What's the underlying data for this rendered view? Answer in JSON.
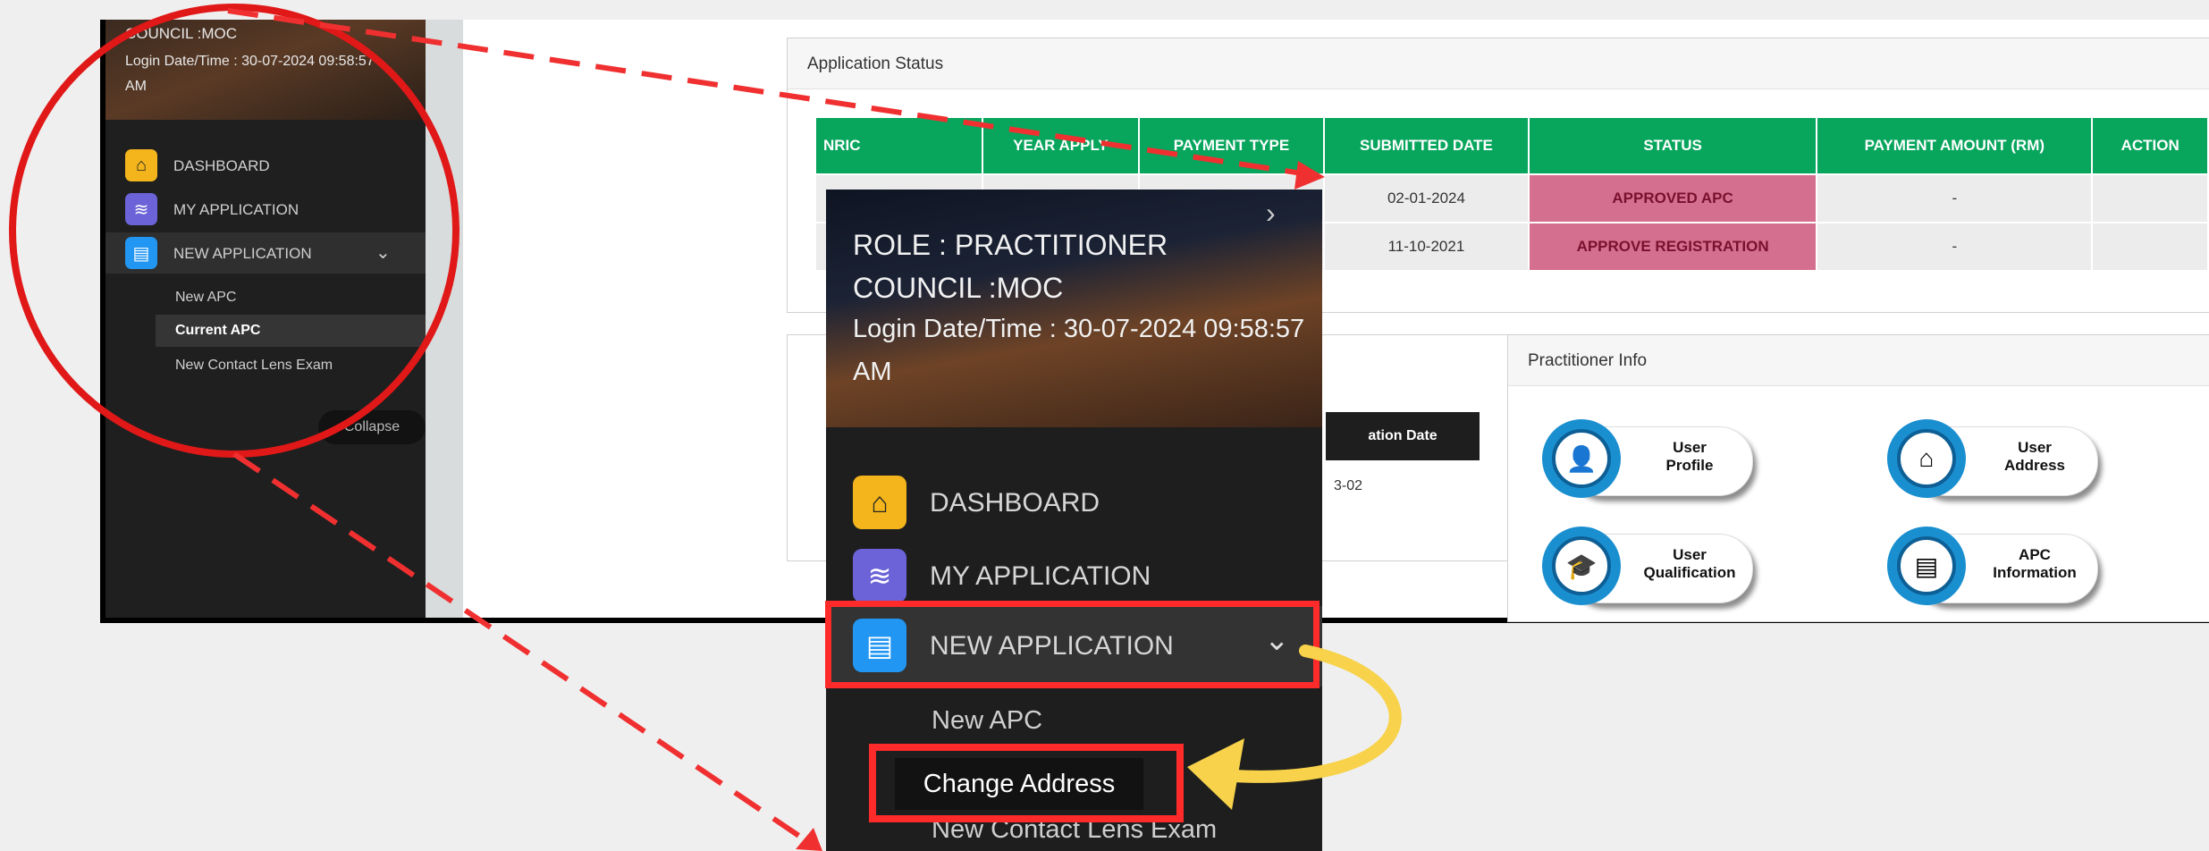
{
  "sidebar": {
    "council": "COUNCIL :MOC",
    "login_line1": "Login Date/Time : 30-07-2024 09:58:57",
    "login_line2": "AM",
    "menu": [
      {
        "label": "DASHBOARD",
        "icon": "home-icon",
        "color": "#f4b51c"
      },
      {
        "label": "MY APPLICATION",
        "icon": "layers-icon",
        "color": "#6c63d8"
      },
      {
        "label": "NEW APPLICATION",
        "icon": "document-icon",
        "color": "#2196f3"
      }
    ],
    "submenu": [
      "New APC",
      "Current APC",
      "New Contact Lens Exam"
    ],
    "collapse_label": "Collapse"
  },
  "application_status": {
    "title": "Application Status",
    "columns": [
      "NRIC",
      "YEAR APPLY",
      "PAYMENT TYPE",
      "SUBMITTED DATE",
      "STATUS",
      "PAYMENT AMOUNT (RM)",
      "ACTION"
    ],
    "rows": [
      {
        "submitted": "02-01-2024",
        "status": "APPROVED APC",
        "amount": "-"
      },
      {
        "submitted": "11-10-2021",
        "status": "APPROVE REGISTRATION",
        "amount": "-"
      }
    ]
  },
  "registration": {
    "header": "ation Date",
    "value": "3-02"
  },
  "practitioner_info": {
    "title": "Practitioner Info",
    "buttons": [
      {
        "label_line1": "User",
        "label_line2": "Profile",
        "icon": "user-icon"
      },
      {
        "label_line1": "User",
        "label_line2": "Address",
        "icon": "house-icon"
      },
      {
        "label_line1": "User",
        "label_line2": "Qualification",
        "icon": "graduation-cap-icon"
      },
      {
        "label_line1": "APC",
        "label_line2": "Information",
        "icon": "document-list-icon"
      }
    ]
  },
  "zoom_inset": {
    "role": "ROLE : PRACTITIONER",
    "council": "COUNCIL :MOC",
    "login_line1": "Login Date/Time : 30-07-2024 09:58:57",
    "login_line2": "AM",
    "menu": [
      {
        "label": "DASHBOARD",
        "icon": "home-icon"
      },
      {
        "label": "MY APPLICATION",
        "icon": "layers-icon"
      },
      {
        "label": "NEW APPLICATION",
        "icon": "document-icon"
      }
    ],
    "submenu": [
      "New APC",
      "Change Address",
      "New Contact Lens Exam"
    ]
  },
  "colors": {
    "highlight_red": "#ff2b2b",
    "arrow_yellow": "#f7d24a",
    "table_header_green": "#08a55d",
    "status_pink": "#d46f8f"
  }
}
